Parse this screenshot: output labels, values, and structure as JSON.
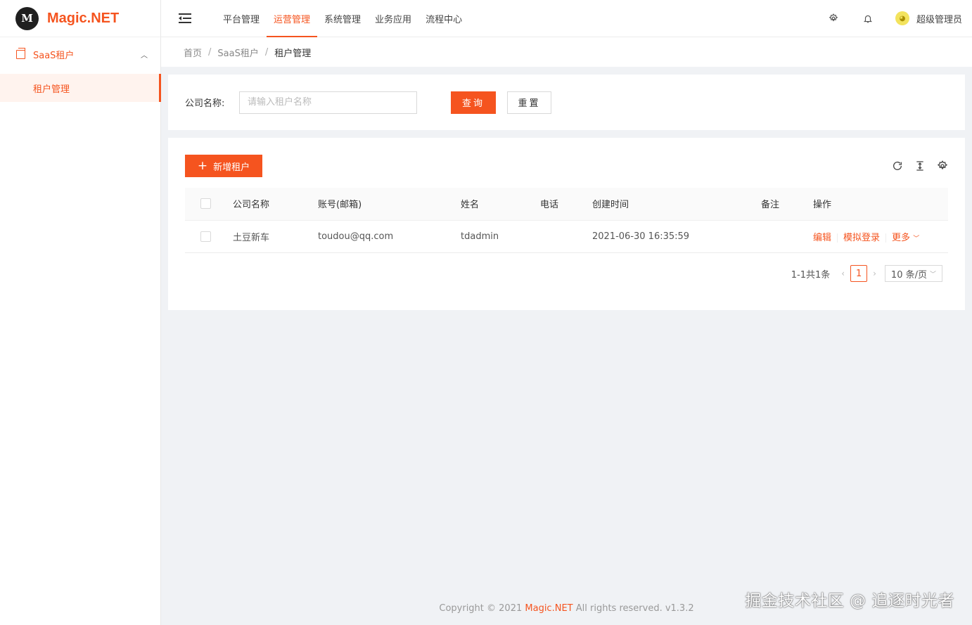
{
  "app": {
    "logo_mark": "M",
    "name": "Magic.NET"
  },
  "sidebar": {
    "group": {
      "label": "SaaS租户",
      "icon": "copy-icon"
    },
    "items": [
      {
        "label": "租户管理",
        "active": true
      }
    ]
  },
  "header": {
    "nav": [
      "平台管理",
      "运营管理",
      "系统管理",
      "业务应用",
      "流程中心"
    ],
    "active_nav": "运营管理",
    "user": "超级管理员"
  },
  "breadcrumb": [
    "首页",
    "SaaS租户",
    "租户管理"
  ],
  "search": {
    "label": "公司名称:",
    "placeholder": "请输入租户名称",
    "value": "",
    "query_label": "查询",
    "reset_label": "重置"
  },
  "toolbar": {
    "add_label": "新增租户"
  },
  "table": {
    "columns": [
      "公司名称",
      "账号(邮箱)",
      "姓名",
      "电话",
      "创建时间",
      "备注",
      "操作"
    ],
    "rows": [
      {
        "company": "土豆新车",
        "account": "toudou@qq.com",
        "name": "tdadmin",
        "phone": "",
        "created": "2021-06-30 16:35:59",
        "remark": ""
      }
    ],
    "actions": {
      "edit": "编辑",
      "impersonate": "模拟登录",
      "more": "更多"
    }
  },
  "pagination": {
    "summary": "1-1共1条",
    "current_page": "1",
    "page_size": "10 条/页"
  },
  "footer": {
    "prefix": "Copyright © 2021",
    "brand": "Magic.NET",
    "suffix": "All rights reserved. v1.3.2"
  },
  "watermark": "掘金技术社区 @ 追逐时光者",
  "colors": {
    "accent": "#f5541f",
    "background": "#f0f2f5"
  }
}
